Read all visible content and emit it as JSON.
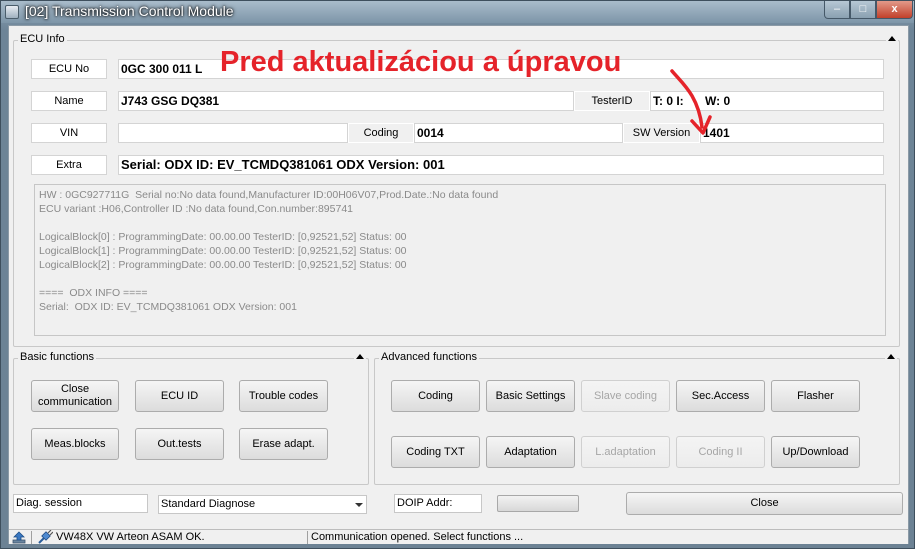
{
  "window": {
    "title": "[02] Transmission Control Module",
    "minimize_symbol": "–",
    "maximize_symbol": "□",
    "close_symbol": "x"
  },
  "overlay_text": "Pred aktualizáciou a úpravou",
  "ecu_info": {
    "group_label": "ECU Info",
    "ecu_no_label": "ECU No",
    "ecu_no_value": "0GC 300 011 L",
    "name_label": "Name",
    "name_value": "J743  GSG DQ381",
    "testerid_label": "TesterID",
    "testerid_value": "T: 0 I:",
    "testerid_value2": "W: 0",
    "vin_label": "VIN",
    "vin_value": "",
    "coding_label": "Coding",
    "coding_value": "0014",
    "sw_version_label": "SW Version",
    "sw_version_value": "1401",
    "extra_label": "Extra",
    "extra_value": "Serial:  ODX ID: EV_TCMDQ381061 ODX Version: 001",
    "details": "HW : 0GC927711G  Serial no:No data found,Manufacturer ID:00H06V07,Prod.Date.:No data found\nECU variant :H06,Controller ID :No data found,Con.number:895741\n\nLogicalBlock[0] : ProgrammingDate: 00.00.00 TesterID: [0,92521,52] Status: 00\nLogicalBlock[1] : ProgrammingDate: 00.00.00 TesterID: [0,92521,52] Status: 00\nLogicalBlock[2] : ProgrammingDate: 00.00.00 TesterID: [0,92521,52] Status: 00\n\n====  ODX INFO ====\nSerial:  ODX ID: EV_TCMDQ381061 ODX Version: 001"
  },
  "basic_functions": {
    "group_label": "Basic functions",
    "close_communication": "Close communication",
    "ecu_id": "ECU ID",
    "trouble_codes": "Trouble codes",
    "meas_blocks": "Meas.blocks",
    "out_tests": "Out.tests",
    "erase_adapt": "Erase adapt."
  },
  "advanced_functions": {
    "group_label": "Advanced functions",
    "coding": "Coding",
    "basic_settings": "Basic Settings",
    "slave_coding": "Slave coding",
    "sec_access": "Sec.Access",
    "flasher": "Flasher",
    "coding_txt": "Coding TXT",
    "adaptation": "Adaptation",
    "l_adaptation": "L.adaptation",
    "coding_ii": "Coding II",
    "up_download": "Up/Download"
  },
  "bottom": {
    "diag_session_label": "Diag. session",
    "diag_session_value": "Standard Diagnose",
    "doip_addr_label": "DOIP Addr:",
    "close_button": "Close"
  },
  "status": {
    "connection": "VW48X VW Arteon ASAM OK.",
    "message": "Communication opened. Select functions ..."
  },
  "colors": {
    "accent_red": "#e5232a",
    "window_chrome": "#7d95a8",
    "close_button": "#c2402a"
  }
}
